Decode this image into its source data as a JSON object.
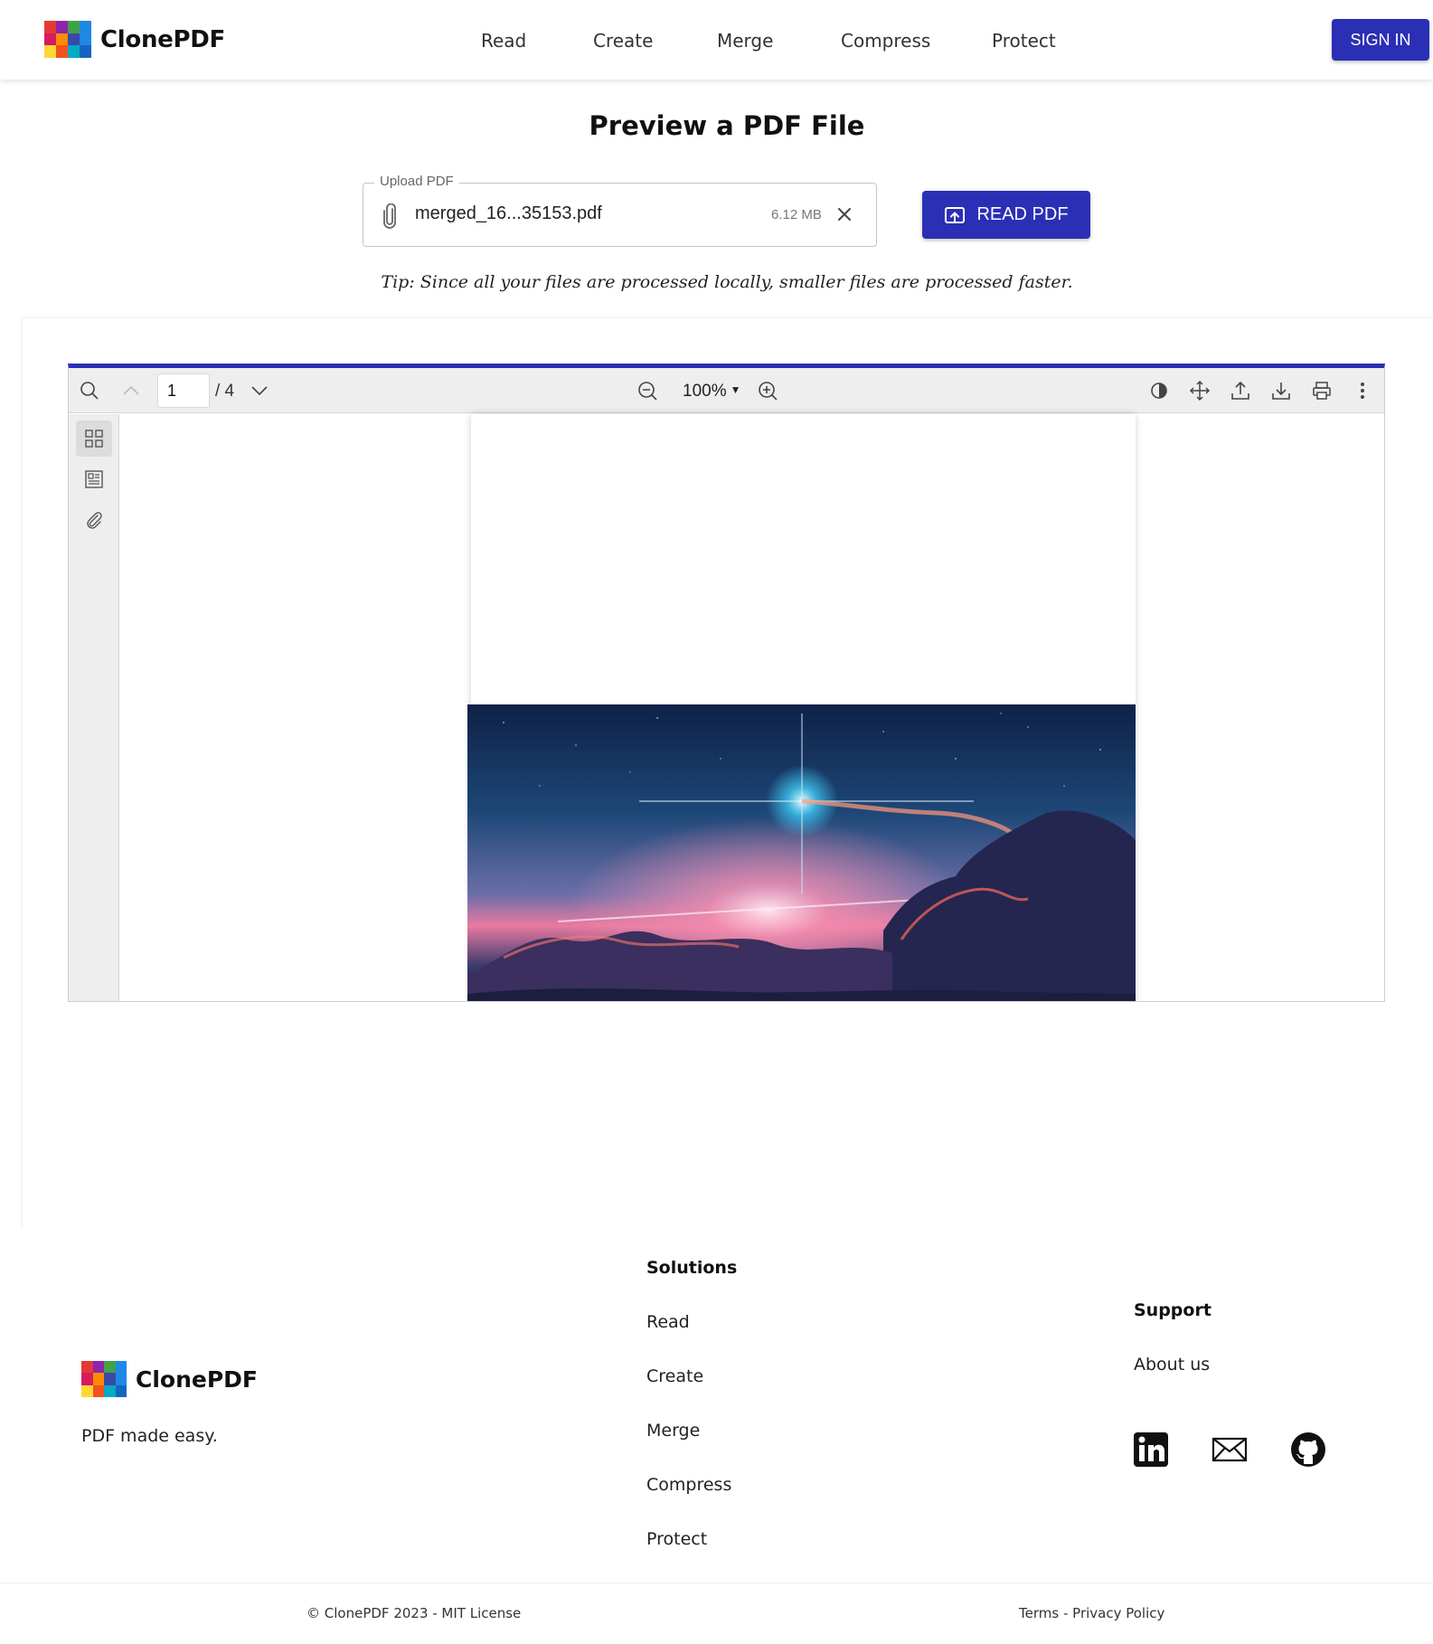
{
  "header": {
    "brand": "ClonePDF",
    "nav": [
      {
        "label": "Read"
      },
      {
        "label": "Create"
      },
      {
        "label": "Merge"
      },
      {
        "label": "Compress"
      },
      {
        "label": "Protect"
      }
    ],
    "sign_in": "SIGN IN"
  },
  "main": {
    "title": "Preview a PDF File",
    "upload": {
      "legend": "Upload PDF",
      "file_name": "merged_16...35153.pdf",
      "file_size": "6.12 MB"
    },
    "read_button": "READ PDF",
    "tip": "Tip: Since all your files are processed locally, smaller files are processed faster."
  },
  "viewer": {
    "current_page": "1",
    "page_total": "/ 4",
    "zoom": "100%",
    "accent_color": "#2b2fb5",
    "toolbar_icons": [
      "search-icon",
      "previous-page-icon",
      "next-page-icon",
      "zoom-out-icon",
      "zoom-in-icon",
      "theme-icon",
      "pan-icon",
      "open-file-icon",
      "download-icon",
      "print-icon",
      "more-options-icon"
    ],
    "sidebar_icons": [
      "thumbnails-icon",
      "outline-icon",
      "attachments-icon"
    ]
  },
  "footer": {
    "brand": "ClonePDF",
    "tagline": "PDF made easy.",
    "solutions": {
      "heading": "Solutions",
      "links": [
        "Read",
        "Create",
        "Merge",
        "Compress",
        "Protect"
      ]
    },
    "support": {
      "heading": "Support",
      "links": [
        "About us"
      ]
    },
    "social_icons": [
      "linkedin-icon",
      "mail-icon",
      "github-icon"
    ],
    "copyright": "© ClonePDF 2023 - MIT License",
    "terms": "Terms",
    "separator": "-",
    "privacy": "Privacy Policy"
  },
  "colors": {
    "primary": "#2b2fb5"
  }
}
